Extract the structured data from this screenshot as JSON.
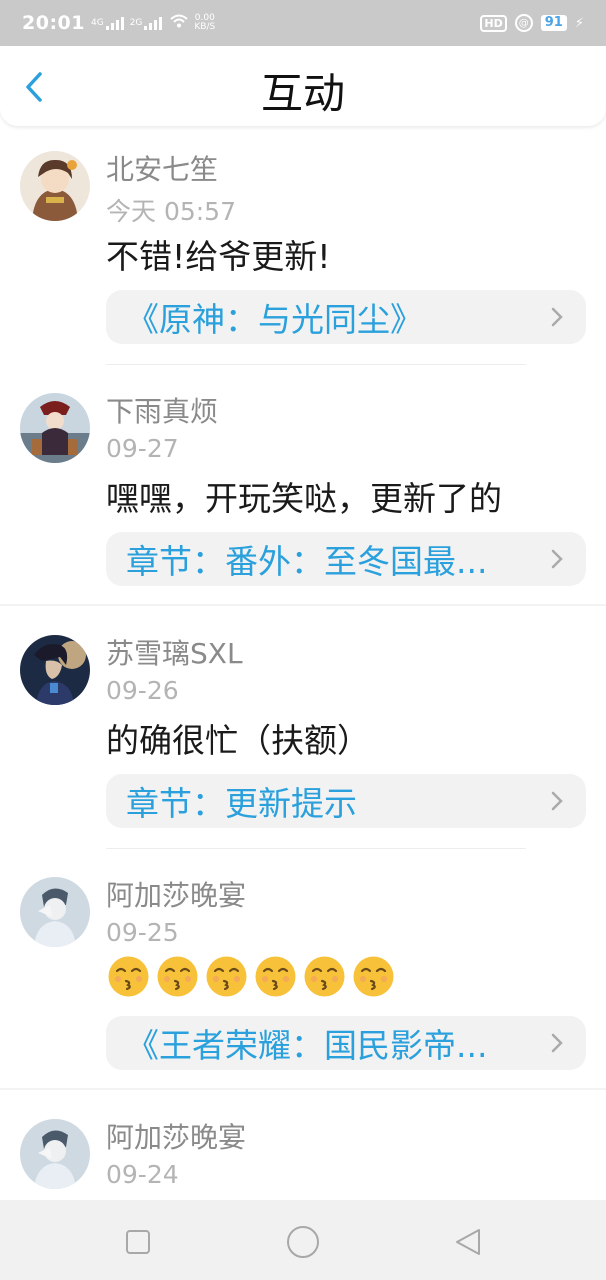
{
  "status_bar": {
    "time": "20:01",
    "signal_1_label": "4G",
    "signal_2_label": "2G",
    "net_speed_value": "0.00",
    "net_speed_unit": "KB/S",
    "hd_label": "HD",
    "battery_level": "91",
    "icons": [
      "signal-icon",
      "wifi-icon",
      "hd-icon",
      "alarm-icon",
      "battery-icon",
      "charging-icon"
    ]
  },
  "header": {
    "title": "互动",
    "back_icon": "chevron-left-icon"
  },
  "colors": {
    "accent": "#2aa0dc",
    "nickname": "#8a8a8a",
    "date": "#b4b4b4",
    "link_bg": "#f2f2f2",
    "status_bar_bg": "#c9c9c9"
  },
  "comments": [
    {
      "nickname": "北安七笙",
      "date": "今天 05:57",
      "text": "不错!给爷更新!",
      "link": "《原神：与光同尘》"
    },
    {
      "nickname": "下雨真烦",
      "date": "09-27",
      "text": "嘿嘿，开玩笑哒，更新了的",
      "link": "章节：番外：至冬国最..."
    },
    {
      "nickname": "苏雪璃SXL",
      "date": "09-26",
      "text": "的确很忙（扶额）",
      "link": "章节：更新提示"
    },
    {
      "nickname": "阿加莎晚宴",
      "date": "09-25",
      "emoji_count": 6,
      "emoji_icon": "kissing-face-emoji",
      "link": "《王者荣耀：国民影帝..."
    },
    {
      "nickname": "阿加莎晚宴",
      "date": "09-24"
    }
  ],
  "nav_bar": {
    "buttons": [
      "recent-apps-icon",
      "home-icon",
      "back-triangle-icon"
    ]
  }
}
